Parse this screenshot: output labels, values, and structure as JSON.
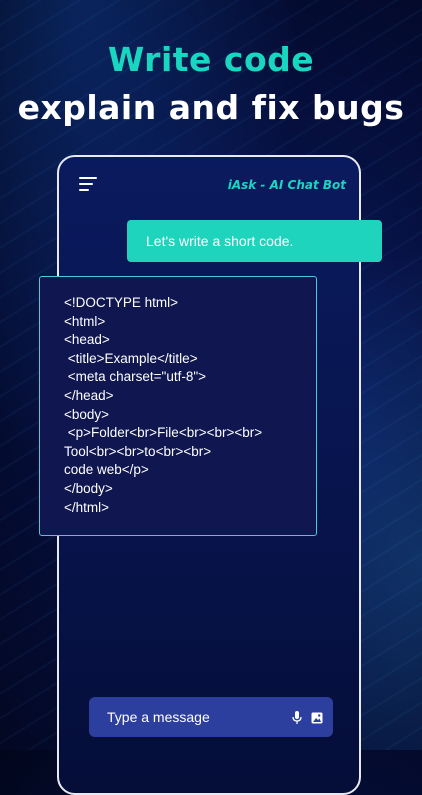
{
  "promo": {
    "headline_line1": "Write code",
    "headline_line2": "explain and fix bugs"
  },
  "app": {
    "title": "iAsk - AI Chat Bot",
    "accent_color": "#19d6c0"
  },
  "chat": {
    "user_message": "Let's write a short code.",
    "code_lines": [
      "<!DOCTYPE html>",
      "<html>",
      "<head>",
      " <title>Example</title>",
      " <meta charset=\"utf-8\">",
      "</head>",
      "<body>",
      " <p>Folder<br>File<br><br><br>",
      "Tool<br><br>to<br><br>",
      "code web</p>",
      "</body>",
      "</html>"
    ]
  },
  "composer": {
    "placeholder": "Type a message",
    "icons": [
      "microphone-icon",
      "image-icon"
    ]
  }
}
